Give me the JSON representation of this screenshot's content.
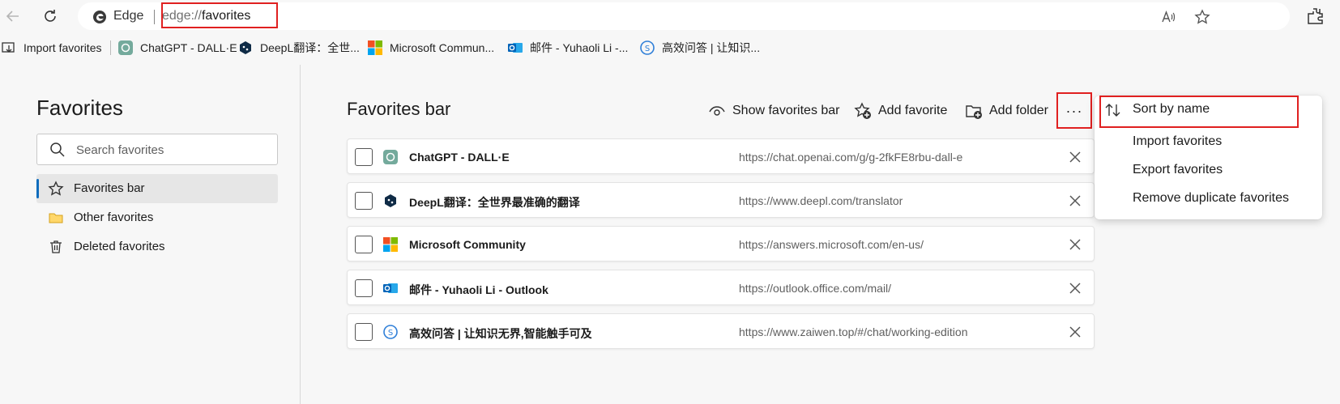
{
  "browser": {
    "brand": "Edge",
    "url_scheme": "edge://",
    "url_path": "favorites"
  },
  "bookmarks_bar": [
    {
      "label": "Import favorites",
      "icon": "import-icon"
    },
    {
      "label": "ChatGPT - DALL·E",
      "icon": "chatgpt-icon"
    },
    {
      "label": "DeepL翻译：全世...",
      "icon": "deepl-icon"
    },
    {
      "label": "Microsoft Commun...",
      "icon": "microsoft-icon"
    },
    {
      "label": "邮件 - Yuhaoli Li -...",
      "icon": "outlook-icon"
    },
    {
      "label": "高效问答 | 让知识...",
      "icon": "zaiwen-icon"
    }
  ],
  "sidebar": {
    "title": "Favorites",
    "search_placeholder": "Search favorites",
    "items": [
      {
        "label": "Favorites bar",
        "icon": "star-icon",
        "active": true
      },
      {
        "label": "Other favorites",
        "icon": "folder-icon",
        "active": false
      },
      {
        "label": "Deleted favorites",
        "icon": "trash-icon",
        "active": false
      }
    ]
  },
  "main": {
    "title": "Favorites bar",
    "actions": {
      "show_bar": "Show favorites bar",
      "add_favorite": "Add favorite",
      "add_folder": "Add folder",
      "more": "···"
    },
    "rows": [
      {
        "name": "ChatGPT - DALL·E",
        "url": "https://chat.openai.com/g/g-2fkFE8rbu-dall-e",
        "icon": "chatgpt-icon"
      },
      {
        "name": "DeepL翻译：全世界最准确的翻译",
        "url": "https://www.deepl.com/translator",
        "icon": "deepl-icon"
      },
      {
        "name": "Microsoft Community",
        "url": "https://answers.microsoft.com/en-us/",
        "icon": "microsoft-icon"
      },
      {
        "name": "邮件 - Yuhaoli Li - Outlook",
        "url": "https://outlook.office.com/mail/",
        "icon": "outlook-icon"
      },
      {
        "name": "高效问答 | 让知识无界,智能触手可及",
        "url": "https://www.zaiwen.top/#/chat/working-edition",
        "icon": "zaiwen-icon"
      }
    ]
  },
  "menu": {
    "items": [
      {
        "label": "Sort by name",
        "icon": "sort-icon"
      },
      {
        "label": "Import favorites"
      },
      {
        "label": "Export favorites"
      },
      {
        "label": "Remove duplicate favorites"
      }
    ]
  },
  "colors": {
    "highlight_box": "#e02020",
    "accent": "#0f6cbd"
  }
}
